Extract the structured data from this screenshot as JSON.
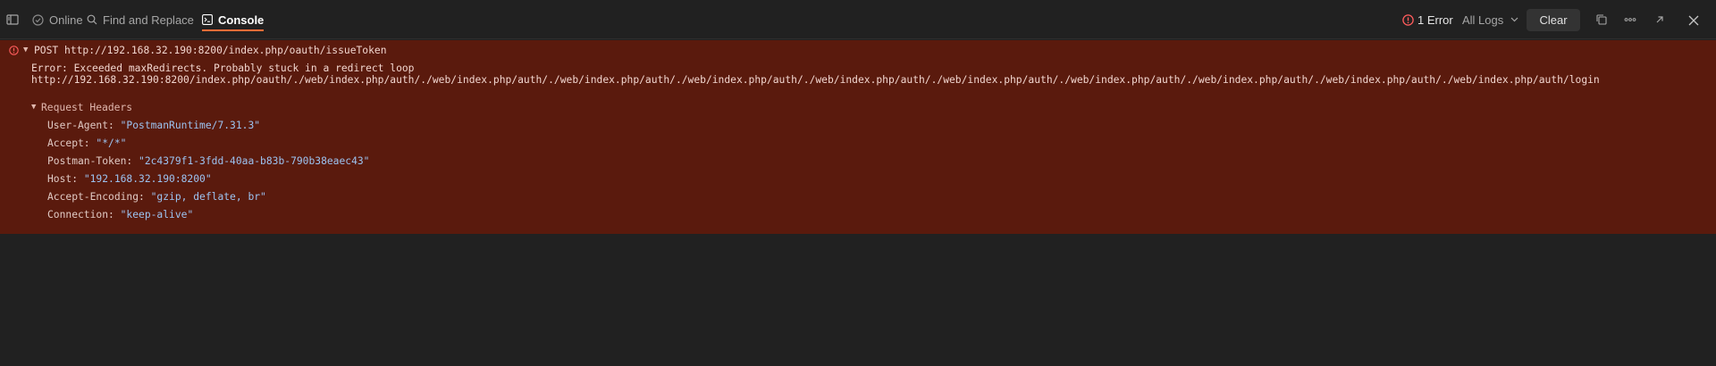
{
  "toolbar": {
    "online_label": "Online",
    "find_replace_label": "Find and Replace",
    "console_label": "Console",
    "error_count_label": "1 Error",
    "log_filter_label": "All Logs",
    "clear_label": "Clear"
  },
  "log": {
    "method": "POST",
    "url": "http://192.168.32.190:8200/index.php/oauth/issueToken",
    "error_message": "Error: Exceeded maxRedirects. Probably stuck in a redirect loop",
    "error_url": "http://192.168.32.190:8200/index.php/oauth/./web/index.php/auth/./web/index.php/auth/./web/index.php/auth/./web/index.php/auth/./web/index.php/auth/./web/index.php/auth/./web/index.php/auth/./web/index.php/auth/./web/index.php/auth/./web/index.php/auth/login",
    "headers_title": "Request Headers",
    "headers": [
      {
        "key": "User-Agent: ",
        "value": "\"PostmanRuntime/7.31.3\""
      },
      {
        "key": "Accept: ",
        "value": "\"*/*\""
      },
      {
        "key": "Postman-Token: ",
        "value": "\"2c4379f1-3fdd-40aa-b83b-790b38eaec43\""
      },
      {
        "key": "Host: ",
        "value": "\"192.168.32.190:8200\""
      },
      {
        "key": "Accept-Encoding: ",
        "value": "\"gzip, deflate, br\""
      },
      {
        "key": "Connection: ",
        "value": "\"keep-alive\""
      }
    ]
  },
  "colors": {
    "background": "#212121",
    "error_block": "#5a1a0d",
    "accent": "#ff6c37",
    "error_icon": "#ff5c5c",
    "header_value": "#9cc3f0"
  },
  "icons": [
    "sidebar-icon",
    "online-check-icon",
    "search-icon",
    "console-icon",
    "error-icon",
    "chevron-down-icon",
    "copy-icon",
    "more-icon",
    "popout-icon",
    "close-icon"
  ]
}
